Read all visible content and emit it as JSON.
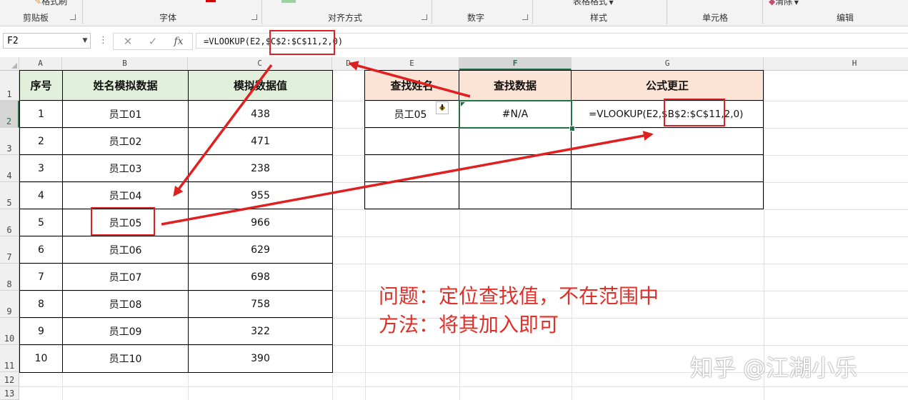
{
  "ribbon": {
    "groups": [
      "剪贴板",
      "字体",
      "对齐方式",
      "数字",
      "样式",
      "单元格",
      "编辑"
    ],
    "partial": {
      "format_painter": "格式刷",
      "table_format": "表格格式",
      "clear": "清除"
    }
  },
  "formula_bar": {
    "name_box": "F2",
    "cancel_icon": "✕",
    "enter_icon": "✓",
    "fx_label": "fx",
    "formula": "=VLOOKUP(E2,$C$2:$C$11,2,0)"
  },
  "columns": [
    "A",
    "B",
    "C",
    "D",
    "E",
    "F",
    "G",
    "H"
  ],
  "selected_column": "F",
  "selected_row": "2",
  "rows": [
    "1",
    "2",
    "3",
    "4",
    "5",
    "6",
    "7",
    "8",
    "9",
    "10",
    "11",
    "12",
    "13"
  ],
  "table_left": {
    "headers": [
      "序号",
      "姓名模拟数据",
      "模拟数据值"
    ],
    "rows": [
      [
        "1",
        "员工01",
        "438"
      ],
      [
        "2",
        "员工02",
        "471"
      ],
      [
        "3",
        "员工03",
        "238"
      ],
      [
        "4",
        "员工04",
        "955"
      ],
      [
        "5",
        "员工05",
        "966"
      ],
      [
        "6",
        "员工06",
        "629"
      ],
      [
        "7",
        "员工07",
        "698"
      ],
      [
        "8",
        "员工08",
        "758"
      ],
      [
        "9",
        "员工09",
        "322"
      ],
      [
        "10",
        "员工10",
        "390"
      ]
    ]
  },
  "table_right": {
    "headers": [
      "查找姓名",
      "查找数据",
      "公式更正"
    ],
    "row": [
      "员工05",
      "#N/A",
      "=VLOOKUP(E2,$B$2:$C$11,2,0)"
    ]
  },
  "annotations": {
    "problem": "问题：定位查找值，不在范围中",
    "method": "方法：将其加入即可"
  },
  "watermark": "知乎 @江湖小乐",
  "colors": {
    "accent_green": "#217346",
    "header_green": "#e2efda",
    "header_orange": "#fbe3d6",
    "annotation_red": "#e02020"
  }
}
